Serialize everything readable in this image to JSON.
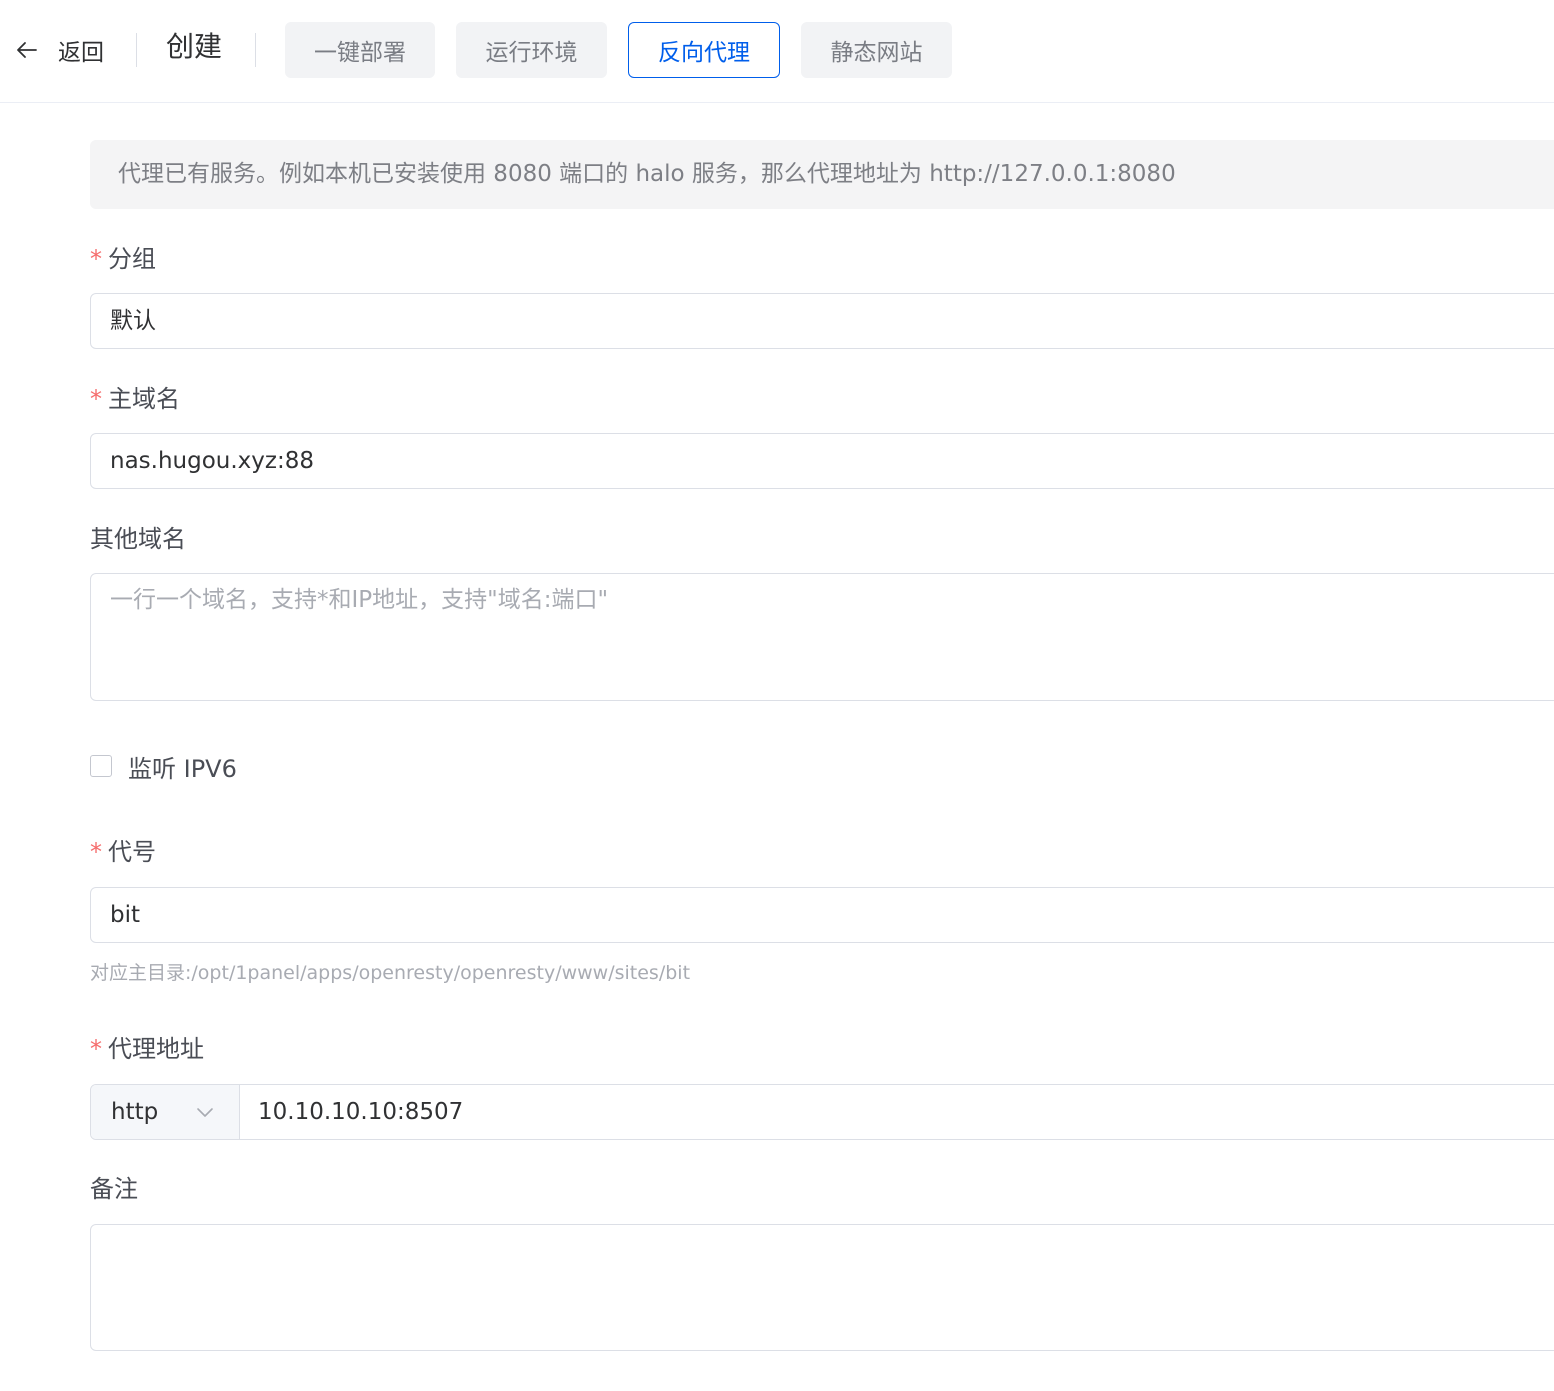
{
  "header": {
    "back_label": "返回",
    "title": "创建",
    "tabs": [
      {
        "label": "一键部署",
        "active": false
      },
      {
        "label": "运行环境",
        "active": false
      },
      {
        "label": "反向代理",
        "active": true
      },
      {
        "label": "静态网站",
        "active": false
      }
    ]
  },
  "form": {
    "notice": "代理已有服务。例如本机已安装使用 8080 端口的 halo 服务，那么代理地址为 http://127.0.0.1:8080",
    "required_mark": "*",
    "group": {
      "label": "分组",
      "value": "默认"
    },
    "primary_domain": {
      "label": "主域名",
      "value": "nas.hugou.xyz:88"
    },
    "other_domains": {
      "label": "其他域名",
      "placeholder": "一行一个域名，支持*和IP地址，支持\"域名:端口\""
    },
    "ipv6": {
      "label": "监听 IPV6",
      "checked": false
    },
    "alias": {
      "label": "代号",
      "value": "bit",
      "hint": "对应主目录:/opt/1panel/apps/openresty/openresty/www/sites/bit"
    },
    "proxy_address": {
      "label": "代理地址",
      "protocol": "http",
      "value": "10.10.10.10:8507"
    },
    "remark": {
      "label": "备注",
      "value": ""
    }
  },
  "colors": {
    "primary": "#005eeb",
    "required": "#f56c6c",
    "border": "#dcdfe6",
    "muted_text": "#a8abb2"
  },
  "icons": {
    "back": "arrow-left-icon",
    "select": "chevron-down-icon"
  }
}
